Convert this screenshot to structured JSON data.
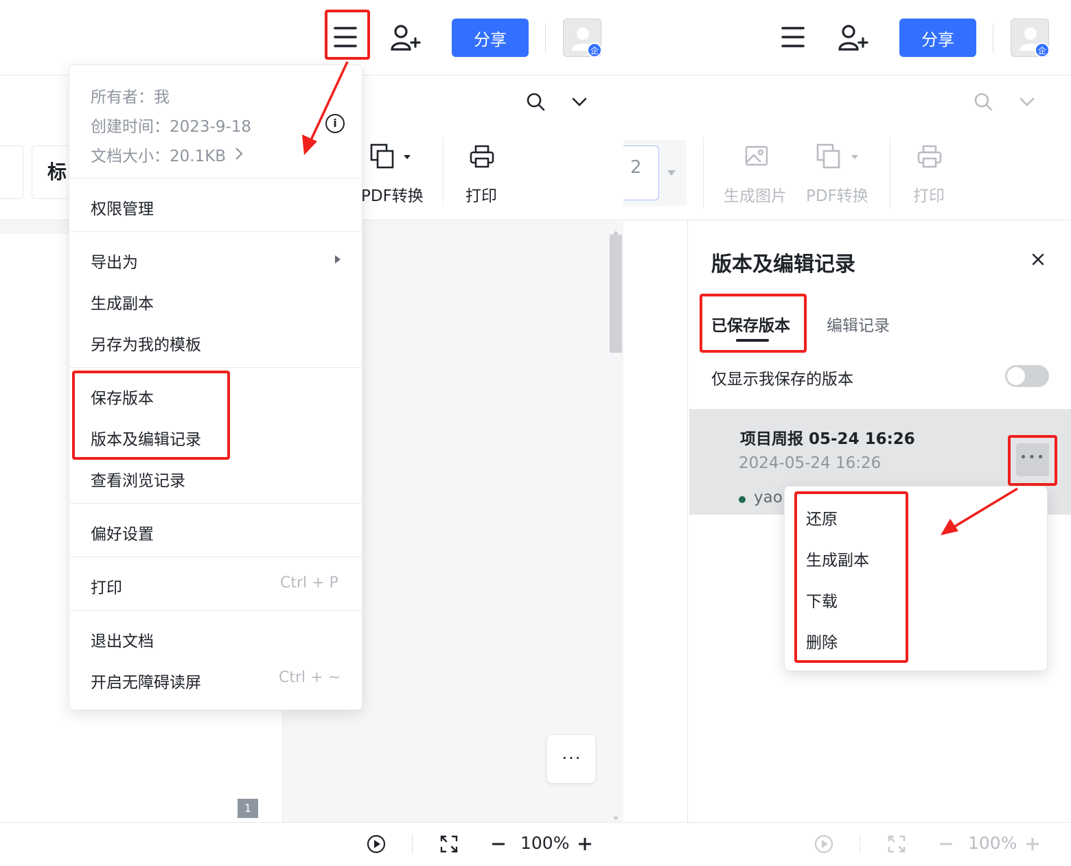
{
  "header": {
    "share_label": "分享",
    "avatar_badge": "企",
    "share_label_right": "分享",
    "avatar_badge_right": "企"
  },
  "toolbar_left": {
    "style_label_partial": "标",
    "pdf_label_partial": "PDF转换",
    "print_label": "打印"
  },
  "toolbar_right": {
    "page_box_partial": "2",
    "gen_image_label": "生成图片",
    "pdf_label": "PDF转换",
    "print_label": "打印"
  },
  "doc": {
    "page_number": "1",
    "more_dots": "···"
  },
  "file_menu": {
    "owner": "所有者：我",
    "created": "创建时间：2023-9-18",
    "size": "文档大小：20.1KB",
    "info_icon": "i",
    "items": {
      "permissions": "权限管理",
      "export_as": "导出为",
      "make_copy": "生成副本",
      "save_as_template": "另存为我的模板",
      "save_version": "保存版本",
      "version_history": "版本及编辑记录",
      "view_history": "查看浏览记录",
      "preferences": "偏好设置",
      "print": "打印",
      "print_shortcut": "Ctrl + P",
      "exit_doc": "退出文档",
      "accessibility": "开启无障碍读屏",
      "accessibility_shortcut": "Ctrl + ~"
    }
  },
  "version_panel": {
    "title": "版本及编辑记录",
    "tabs": [
      "已保存版本",
      "编辑记录"
    ],
    "active_tab": "已保存版本",
    "only_mine_label": "仅显示我保存的版本",
    "only_mine_on": false,
    "version": {
      "name": "项目周报 05-24 16:26",
      "datetime": "2024-05-24 16:26",
      "author": "yao"
    },
    "more_dots": "•••",
    "context_menu": [
      "还原",
      "生成副本",
      "下载",
      "删除"
    ]
  },
  "statusbar": {
    "zoom": "100%",
    "zoom_right": "100%"
  },
  "colors": {
    "accent": "#3370ff",
    "highlight_red": "#f0201c",
    "author_dot": "#1f6b4f"
  }
}
